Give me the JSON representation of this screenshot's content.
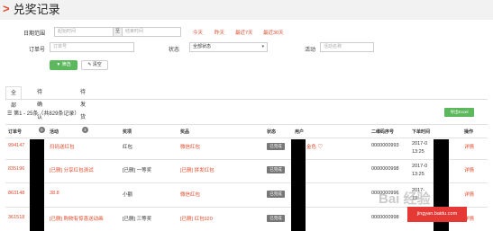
{
  "page": {
    "title": "兑奖记录"
  },
  "filters": {
    "date_label": "日期范围",
    "start_placeholder": "起始时间",
    "to_label": "至",
    "end_placeholder": "结束时间",
    "quick": [
      "今天",
      "昨天",
      "最近7天",
      "最近30天"
    ],
    "order_label": "订单号",
    "order_placeholder": "订单号",
    "status_label": "状态",
    "status_value": "全部状态",
    "activity_label": "活动",
    "activity_placeholder": "活动名称",
    "filter_button": "筛选",
    "clear_button": "清空"
  },
  "tabs": [
    {
      "label": "全部",
      "count": ""
    },
    {
      "label": "待确认",
      "count": "0"
    },
    {
      "label": "待发货",
      "count": "3"
    }
  ],
  "records_text": "第1 - 25条（共829条记录）",
  "export_button": "导出Excel",
  "columns": [
    "订单号",
    "活动",
    "奖项",
    "奖品",
    "状态",
    "用户",
    "二维码序号",
    "下单时间",
    "操作"
  ],
  "rows": [
    {
      "order": "994147",
      "activity": "扫码送红包",
      "prize_level": "红包",
      "prize": "微信红包",
      "status": "已完成",
      "user": "金色",
      "qr": "0000000993",
      "time": "2017-0",
      "time2": "13:25",
      "action": "详情"
    },
    {
      "order": "835196",
      "activity": "[已删] 分享红包测试",
      "prize_level": "[已删] 一等奖",
      "prize": "[已删] 拼发红包",
      "status": "已完成",
      "user": "",
      "qr": "0000000998",
      "time": "2017-0",
      "time2": "13:25",
      "action": "详情"
    },
    {
      "order": "863148",
      "activity": "38.8",
      "prize_level": "小额",
      "prize": "微信红包",
      "status": "已完成",
      "user": "",
      "qr": "0000000996",
      "time": "2017-",
      "time2": "13:",
      "action": "详情"
    },
    {
      "order": "361518",
      "activity": "[已删] 购物有惊喜送动画",
      "prize_level": "[已删] 三等奖",
      "prize": "[已删] 红包920",
      "status": "已完成",
      "user": "",
      "qr": "0000000998",
      "time": "2017-0",
      "time2": "",
      "action": "详情"
    }
  ],
  "colors": {
    "accent": "#e04b2b",
    "green": "#5cb85c",
    "status_gray": "#777777"
  },
  "watermark": {
    "text": "Bai 经验",
    "banner": "jingyan.baidu.com"
  }
}
